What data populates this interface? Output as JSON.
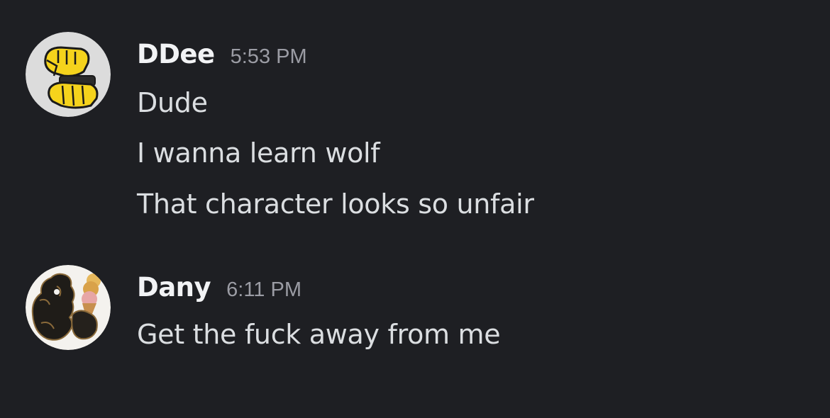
{
  "chat": {
    "messages": [
      {
        "username": "DDee",
        "timestamp": "5:53 PM",
        "avatar_icon": "yellow-robot-fist-icon",
        "lines": [
          "Dude",
          "I wanna learn wolf",
          "That character looks so unfair"
        ]
      },
      {
        "username": "Dany",
        "timestamp": "6:11 PM",
        "avatar_icon": "dark-character-with-ice-cream-icon",
        "lines": [
          "Get the fuck away from me"
        ]
      }
    ]
  },
  "colors": {
    "background": "#1e1f23",
    "username": "#f2f3f5",
    "timestamp": "#9b9ca4",
    "message_text": "#dbdee1"
  }
}
